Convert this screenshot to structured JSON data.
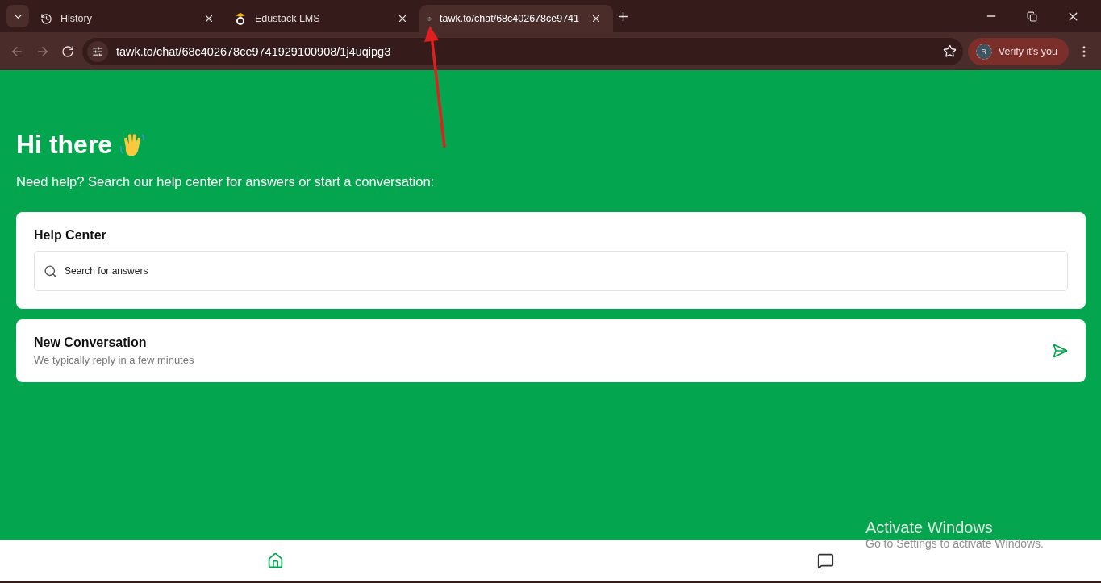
{
  "browser": {
    "tabs": [
      {
        "title": "History",
        "kind": "history",
        "selected": false
      },
      {
        "title": "Edustack LMS",
        "kind": "site",
        "selected": false
      },
      {
        "title": "tawk.to/chat/68c402678ce9741",
        "kind": "web",
        "selected": true
      }
    ],
    "url": "tawk.to/chat/68c402678ce9741929100908/1j4uqipg3",
    "profile": {
      "initial": "R",
      "label": "Verify it's you"
    }
  },
  "page": {
    "greeting": "Hi there",
    "intro": "Need help? Search our help center for answers or start a conversation:",
    "help_center": {
      "title": "Help Center",
      "search": {
        "placeholder": "Search for answers"
      }
    },
    "new_conversation": {
      "title": "New Conversation",
      "subtitle": "We typically reply in a few minutes"
    }
  },
  "bottom_nav": [
    {
      "kind": "home",
      "selected": true
    },
    {
      "kind": "chat",
      "selected": false
    }
  ],
  "overlay": {
    "title": "Activate Windows",
    "subtitle": "Go to Settings to activate Windows."
  }
}
